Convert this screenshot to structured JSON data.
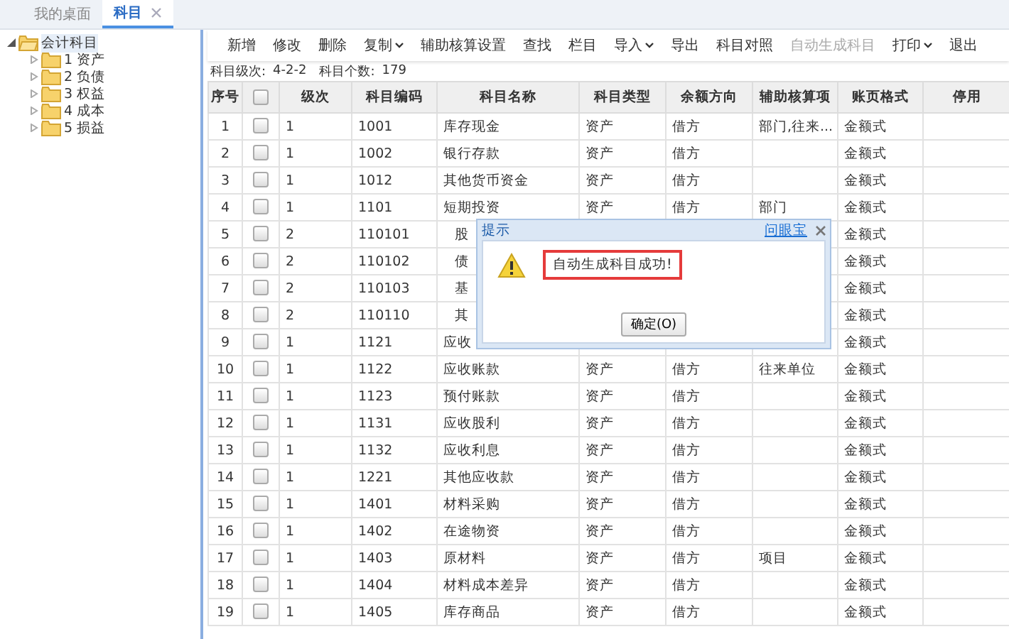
{
  "tabs": [
    {
      "label": "我的桌面",
      "selected": false,
      "closable": false
    },
    {
      "label": "科目",
      "selected": true,
      "closable": true
    }
  ],
  "tree": [
    {
      "label": "会计科目",
      "expanded": true,
      "selected": true,
      "children": [
        {
          "label": "1 资产",
          "expanded": false,
          "selected": false
        },
        {
          "label": "2 负债",
          "expanded": false,
          "selected": false
        },
        {
          "label": "3 权益",
          "expanded": false,
          "selected": false
        },
        {
          "label": "4 成本",
          "expanded": false,
          "selected": false
        },
        {
          "label": "5 损益",
          "expanded": false,
          "selected": false
        }
      ]
    }
  ],
  "toolbar": [
    {
      "label": "新增",
      "dropdown": false,
      "disabled": false
    },
    {
      "label": "修改",
      "dropdown": false,
      "disabled": false
    },
    {
      "label": "删除",
      "dropdown": false,
      "disabled": false
    },
    {
      "label": "复制",
      "dropdown": true,
      "disabled": false
    },
    {
      "label": "辅助核算设置",
      "dropdown": false,
      "disabled": false
    },
    {
      "label": "查找",
      "dropdown": false,
      "disabled": false
    },
    {
      "label": "栏目",
      "dropdown": false,
      "disabled": false
    },
    {
      "label": "导入",
      "dropdown": true,
      "disabled": false
    },
    {
      "label": "导出",
      "dropdown": false,
      "disabled": false
    },
    {
      "label": "科目对照",
      "dropdown": false,
      "disabled": false
    },
    {
      "label": "自动生成科目",
      "dropdown": false,
      "disabled": true
    },
    {
      "label": "打印",
      "dropdown": true,
      "disabled": false
    },
    {
      "label": "退出",
      "dropdown": false,
      "disabled": false
    }
  ],
  "info": {
    "level_label": "科目级次:",
    "level": "4-2-2",
    "count_label": "科目个数:",
    "count": "179"
  },
  "table": {
    "columns": [
      {
        "kind": "text",
        "label": "序号"
      },
      {
        "kind": "checkbox",
        "checked": false
      },
      {
        "kind": "text",
        "label": "级次"
      },
      {
        "kind": "text",
        "label": "科目编码"
      },
      {
        "kind": "text",
        "label": "科目名称"
      },
      {
        "kind": "text",
        "label": "科目类型"
      },
      {
        "kind": "text",
        "label": "余额方向"
      },
      {
        "kind": "text",
        "label": "辅助核算项"
      },
      {
        "kind": "text",
        "label": "账页格式"
      },
      {
        "kind": "text",
        "label": "停用"
      }
    ],
    "rows": [
      {
        "no": "1",
        "checked": false,
        "level": "1",
        "code": "1001",
        "name": "库存现金",
        "child": false,
        "type": "资产",
        "direction": "借方",
        "aux": "部门,往来...",
        "format": "金额式"
      },
      {
        "no": "2",
        "checked": false,
        "level": "1",
        "code": "1002",
        "name": "银行存款",
        "child": false,
        "type": "资产",
        "direction": "借方",
        "format": "金额式"
      },
      {
        "no": "3",
        "checked": false,
        "level": "1",
        "code": "1012",
        "name": "其他货币资金",
        "child": false,
        "type": "资产",
        "direction": "借方",
        "format": "金额式"
      },
      {
        "no": "4",
        "checked": false,
        "level": "1",
        "code": "1101",
        "name": "短期投资",
        "child": false,
        "type": "资产",
        "direction": "借方",
        "aux": "部门",
        "format": "金额式"
      },
      {
        "no": "5",
        "checked": false,
        "level": "2",
        "code": "110101",
        "name": "股",
        "child": true,
        "format": "金额式"
      },
      {
        "no": "6",
        "checked": false,
        "level": "2",
        "code": "110102",
        "name": "债",
        "child": true,
        "format": "金额式"
      },
      {
        "no": "7",
        "checked": false,
        "level": "2",
        "code": "110103",
        "name": "基",
        "child": true,
        "format": "金额式"
      },
      {
        "no": "8",
        "checked": false,
        "level": "2",
        "code": "110110",
        "name": "其",
        "child": true,
        "format": "金额式"
      },
      {
        "no": "9",
        "checked": false,
        "level": "1",
        "code": "1121",
        "name": "应收",
        "child": false,
        "format": "金额式"
      },
      {
        "no": "10",
        "checked": false,
        "level": "1",
        "code": "1122",
        "name": "应收账款",
        "child": false,
        "type": "资产",
        "direction": "借方",
        "aux": "往来单位",
        "format": "金额式"
      },
      {
        "no": "11",
        "checked": false,
        "level": "1",
        "code": "1123",
        "name": "预付账款",
        "child": false,
        "type": "资产",
        "direction": "借方",
        "format": "金额式"
      },
      {
        "no": "12",
        "checked": false,
        "level": "1",
        "code": "1131",
        "name": "应收股利",
        "child": false,
        "type": "资产",
        "direction": "借方",
        "format": "金额式"
      },
      {
        "no": "13",
        "checked": false,
        "level": "1",
        "code": "1132",
        "name": "应收利息",
        "child": false,
        "type": "资产",
        "direction": "借方",
        "format": "金额式"
      },
      {
        "no": "14",
        "checked": false,
        "level": "1",
        "code": "1221",
        "name": "其他应收款",
        "child": false,
        "type": "资产",
        "direction": "借方",
        "format": "金额式"
      },
      {
        "no": "15",
        "checked": false,
        "level": "1",
        "code": "1401",
        "name": "材料采购",
        "child": false,
        "type": "资产",
        "direction": "借方",
        "format": "金额式"
      },
      {
        "no": "16",
        "checked": false,
        "level": "1",
        "code": "1402",
        "name": "在途物资",
        "child": false,
        "type": "资产",
        "direction": "借方",
        "format": "金额式"
      },
      {
        "no": "17",
        "checked": false,
        "level": "1",
        "code": "1403",
        "name": "原材料",
        "child": false,
        "type": "资产",
        "direction": "借方",
        "aux": "项目",
        "format": "金额式"
      },
      {
        "no": "18",
        "checked": false,
        "level": "1",
        "code": "1404",
        "name": "材料成本差异",
        "child": false,
        "type": "资产",
        "direction": "借方",
        "format": "金额式"
      },
      {
        "no": "19",
        "checked": false,
        "level": "1",
        "code": "1405",
        "name": "库存商品",
        "child": false,
        "type": "资产",
        "direction": "借方",
        "format": "金额式"
      }
    ]
  },
  "dialog": {
    "title": "提示",
    "link": "问眼宝",
    "message": "自动生成科目成功!",
    "ok_button": "确定(O)"
  }
}
